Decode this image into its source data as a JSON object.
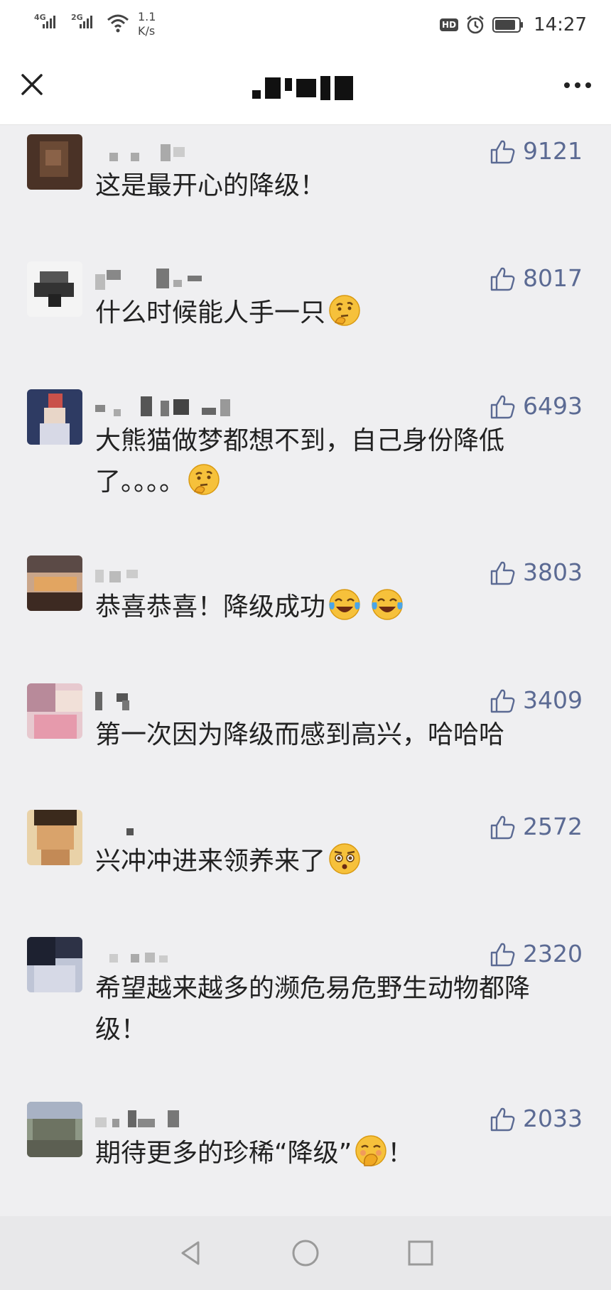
{
  "status_bar": {
    "signal1": "4G",
    "signal2": "2G",
    "net_speed": "1.1",
    "net_unit": "K/s",
    "hd": "HD",
    "time": "14:27"
  },
  "comments": [
    {
      "text": "这是最开心的降级！",
      "likes": "9121",
      "emoji": null
    },
    {
      "text": "什么时候能人手一只",
      "likes": "8017",
      "emoji": "thinking"
    },
    {
      "text": "大熊猫做梦都想不到，自己身份降低了。。。。",
      "likes": "6493",
      "emoji": "thinking"
    },
    {
      "text": "恭喜恭喜！降级成功",
      "likes": "3803",
      "emoji": "tears-of-joy x2"
    },
    {
      "text": "第一次因为降级而感到高兴，哈哈哈",
      "likes": "3409",
      "emoji": null
    },
    {
      "text": "兴冲冲进来领养来了",
      "likes": "2572",
      "emoji": "flushed"
    },
    {
      "text": "希望越来越多的濒危易危野生动物都降级！",
      "likes": "2320",
      "emoji": null
    },
    {
      "text_before": "期待更多的珍稀“降级”",
      "text_after": "！",
      "likes": "2033",
      "emoji": "hand-over-mouth"
    }
  ]
}
